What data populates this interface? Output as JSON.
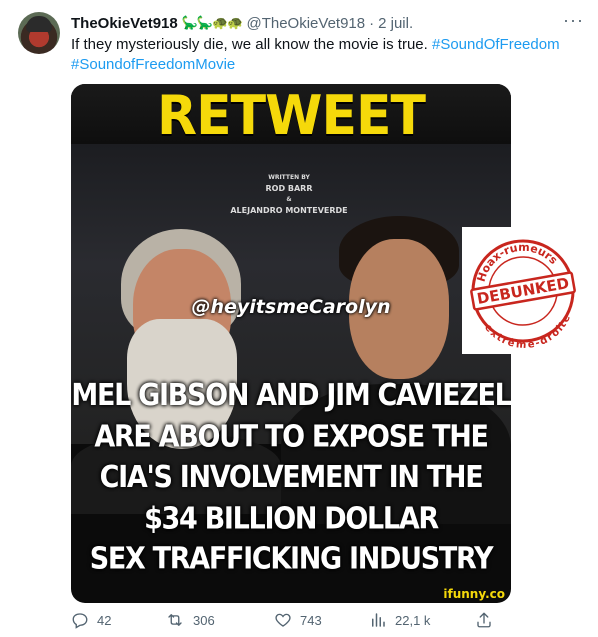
{
  "tweet": {
    "display_name": "TheOkieVet918",
    "name_emojis": "🦕🦕🐢🐢",
    "handle": "@TheOkieVet918",
    "separator": "·",
    "date": "2 juil.",
    "more_label": "···",
    "text_plain": "If they mysteriously die, we all know the movie is true.",
    "hashtag_1": "#SoundOfFreedom",
    "hashtag_2": "#SoundofFreedomMovie"
  },
  "media": {
    "banner_text": "RETWEET",
    "poster_written_by": "WRITTEN BY",
    "poster_name_1": "ROD BARR",
    "poster_amp": "&",
    "poster_name_2": "ALEJANDRO MONTEVERDE",
    "watermark": "@heyitsmeCarolyn",
    "headline_lines": [
      "MEL GIBSON AND JIM CAVIEZEL",
      "ARE ABOUT TO EXPOSE THE",
      "CIA'S INVOLVEMENT IN THE",
      "$34 BILLION DOLLAR",
      "SEX TRAFFICKING INDUSTRY"
    ],
    "source_tag": "ifunny.co"
  },
  "stamp": {
    "top_text": "Hoax-rumeurs",
    "center_text": "DEBUNKED",
    "bottom_text": "extrême-droite",
    "color": "#c8261e"
  },
  "actions": {
    "replies": "42",
    "retweets": "306",
    "likes": "743",
    "views": "22,1 k"
  },
  "colors": {
    "link": "#1d9bf0",
    "muted": "#536471",
    "banner_yellow": "#f5d90a"
  }
}
